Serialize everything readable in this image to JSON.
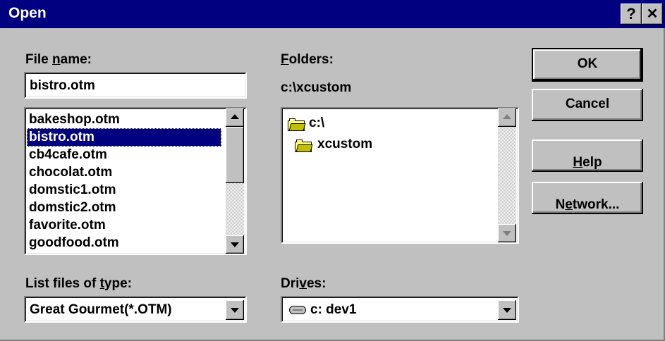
{
  "window": {
    "title": "Open",
    "help_glyph": "?",
    "close_glyph": "✕"
  },
  "file_name": {
    "label_pre": "File ",
    "label_accel": "n",
    "label_post": "ame:",
    "value": "bistro.otm"
  },
  "files": {
    "items": [
      "bakeshop.otm",
      "bistro.otm",
      "cb4cafe.otm",
      "chocolat.otm",
      "domstic1.otm",
      "domstic2.otm",
      "favorite.otm",
      "goodfood.otm"
    ],
    "selected": "bistro.otm"
  },
  "folders": {
    "label_accel": "F",
    "label_post": "olders:",
    "current_path": "c:\\xcustom",
    "tree": [
      "c:\\",
      "xcustom"
    ]
  },
  "file_type": {
    "label_pre": "List files of ",
    "label_accel": "t",
    "label_post": "ype:",
    "value": "Great Gourmet(*.OTM)"
  },
  "drives": {
    "label_pre": "Dri",
    "label_accel": "v",
    "label_post": "es:",
    "value": "c: dev1"
  },
  "buttons": {
    "ok": "OK",
    "cancel": "Cancel",
    "help_accel": "H",
    "help_post": "elp",
    "network_pre": "N",
    "network_accel": "e",
    "network_post": "twork..."
  },
  "icons": {
    "folder": "folder-icon",
    "drive": "drive-icon",
    "scroll_up": "arrow-up-icon",
    "scroll_down": "arrow-down-icon",
    "dropdown": "arrow-down-icon"
  },
  "colors": {
    "title_bar": "#000080",
    "dialog_face": "#c0c0c0",
    "selection": "#000080"
  }
}
